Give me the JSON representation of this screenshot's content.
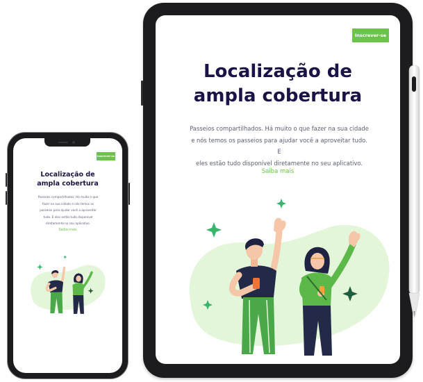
{
  "tablet": {
    "signup_label": "Inscrever-se",
    "title_line1": "Localização de",
    "title_line2": "ampla cobertura",
    "desc_line1": "Passeios compartilhados. Há muito o que fazer na sua cidade",
    "desc_line2": "e nós temos os passeios para ajudar você a aproveitar tudo. E",
    "desc_line3": "eles estão tudo disponível diretamente no seu aplicativo.",
    "link_label": "Saiba mais"
  },
  "phone": {
    "signup_label": "Inscrever-se",
    "title_line1": "Localização de",
    "title_line2": "ampla cobertura",
    "desc_line1": "Passeios compartilhados. Há muito o que",
    "desc_line2": "fazer na sua cidade e nós temos os",
    "desc_line3": "passeios para ajudar você a aproveitar",
    "desc_line4": "tudo. E eles estão tudo disponível",
    "desc_line5": "diretamente no seu aplicativo.",
    "link_label": "Saiba mais"
  },
  "colors": {
    "accent": "#6cc24a",
    "title": "#1a1446",
    "body_text": "#5a5f73",
    "blob": "#e3f6d9",
    "device_frame": "#1c1c1e"
  },
  "icons": [
    "sparkle-icon",
    "apple-pencil"
  ]
}
